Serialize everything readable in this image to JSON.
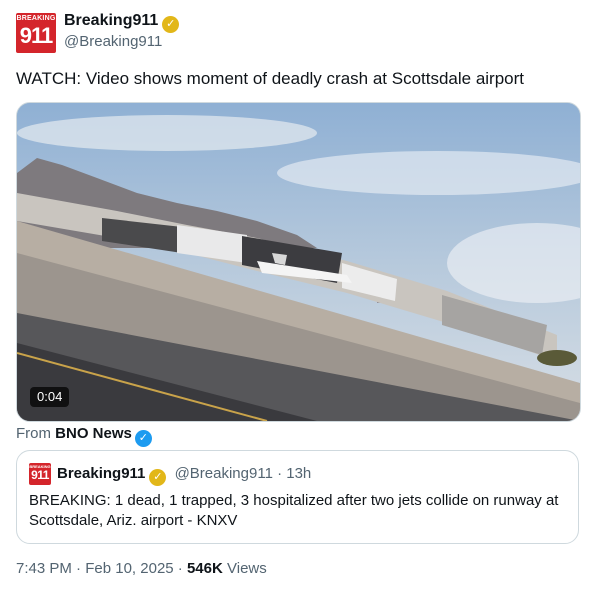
{
  "author": {
    "name": "Breaking911",
    "handle": "@Breaking911",
    "avatar_text_top": "BREAKING",
    "avatar_text_main": "911",
    "badge_color": "#e2b719"
  },
  "tweet": {
    "text": "WATCH: Video shows moment of deadly crash at Scottsdale airport"
  },
  "media": {
    "duration": "0:04",
    "from_label": "From",
    "from_source": "BNO News",
    "source_badge_color": "#1d9bf0"
  },
  "quoted": {
    "name": "Breaking911",
    "handle": "@Breaking911",
    "time": "· 13h",
    "text": "BREAKING: 1 dead, 1 trapped, 3 hospitalized after two jets collide on runway at Scottsdale, Ariz. airport - KNXV",
    "avatar_text_top": "BREAKING",
    "avatar_text_main": "911"
  },
  "footer": {
    "time": "7:43 PM",
    "sep1": "·",
    "date": "Feb 10, 2025",
    "sep2": "·",
    "views_count": "546K",
    "views_label": "Views"
  },
  "colors": {
    "brand_red": "#d4252b",
    "text_primary": "#0f1419",
    "text_secondary": "#536471",
    "border": "#cfd9de"
  }
}
